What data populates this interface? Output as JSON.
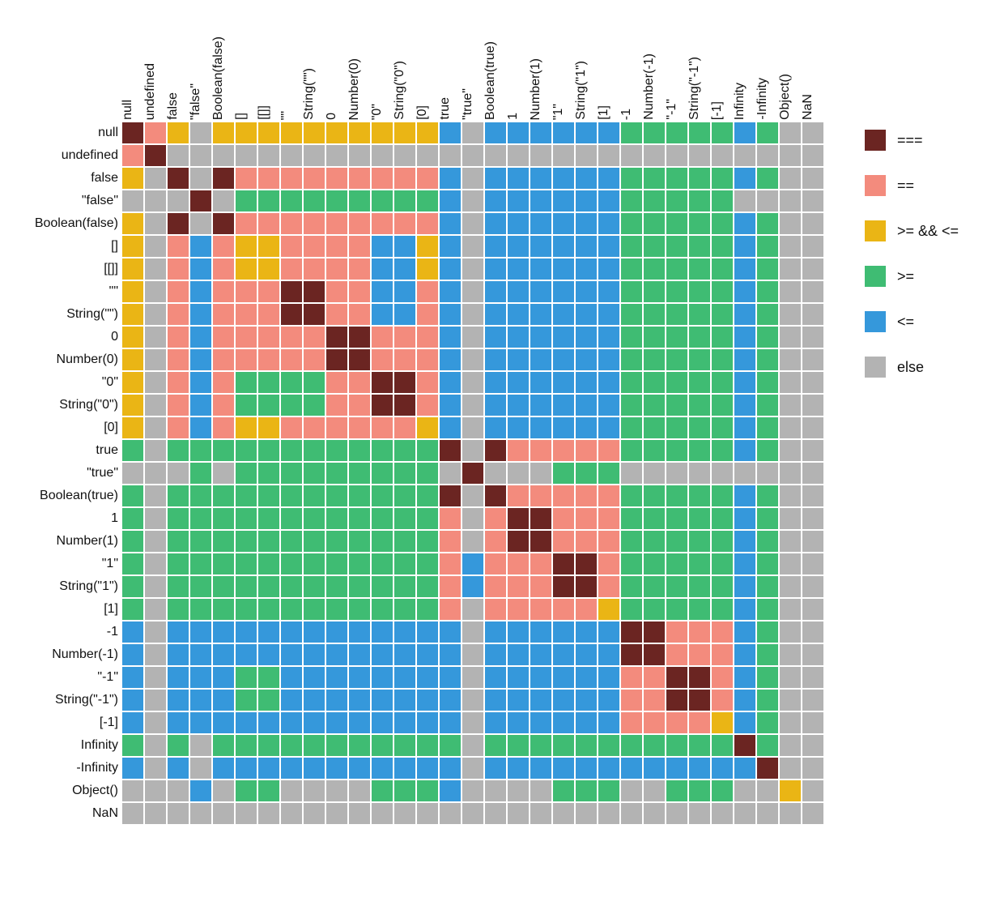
{
  "chart_data": {
    "type": "heatmap",
    "title": "",
    "xlabel": "",
    "ylabel": "",
    "labels": [
      "null",
      "undefined",
      "false",
      "\"false\"",
      "Boolean(false)",
      "[]",
      "[[]]",
      "\"\"",
      "String(\"\")",
      "0",
      "Number(0)",
      "\"0\"",
      "String(\"0\")",
      "[0]",
      "true",
      "\"true\"",
      "Boolean(true)",
      "1",
      "Number(1)",
      "\"1\"",
      "String(\"1\")",
      "[1]",
      "-1",
      "Number(-1)",
      "\"-1\"",
      "String(\"-1\")",
      "[-1]",
      "Infinity",
      "-Infinity",
      "Object()",
      "NaN"
    ],
    "categories": [
      {
        "key": "===",
        "label": "===",
        "color": "#6b2522"
      },
      {
        "key": "==",
        "label": "==",
        "color": "#f38b7d"
      },
      {
        "key": ">= && <=",
        "label": ">= && <=",
        "color": "#eab515"
      },
      {
        "key": ">=",
        "label": ">=",
        "color": "#3fbc73"
      },
      {
        "key": "<=",
        "label": "<=",
        "color": "#3598db"
      },
      {
        "key": "else",
        "label": "else",
        "color": "#b3b3b3"
      }
    ],
    "matrix_encoding": {
      "0": "===",
      "1": "==",
      "2": ">= && <=",
      "3": ">=",
      "4": "<=",
      "5": "else"
    },
    "matrix": [
      [
        0,
        1,
        2,
        5,
        2,
        2,
        2,
        2,
        2,
        2,
        2,
        2,
        2,
        2,
        4,
        5,
        4,
        4,
        4,
        4,
        4,
        4,
        3,
        3,
        3,
        3,
        3,
        4,
        3,
        5,
        5
      ],
      [
        1,
        0,
        5,
        5,
        5,
        5,
        5,
        5,
        5,
        5,
        5,
        5,
        5,
        5,
        5,
        5,
        5,
        5,
        5,
        5,
        5,
        5,
        5,
        5,
        5,
        5,
        5,
        5,
        5,
        5,
        5
      ],
      [
        2,
        5,
        0,
        5,
        0,
        1,
        1,
        1,
        1,
        1,
        1,
        1,
        1,
        1,
        4,
        5,
        4,
        4,
        4,
        4,
        4,
        4,
        3,
        3,
        3,
        3,
        3,
        4,
        3,
        5,
        5
      ],
      [
        5,
        5,
        5,
        0,
        5,
        3,
        3,
        3,
        3,
        3,
        3,
        3,
        3,
        3,
        4,
        5,
        4,
        4,
        4,
        4,
        4,
        4,
        3,
        3,
        3,
        3,
        3,
        5,
        5,
        5,
        5
      ],
      [
        2,
        5,
        0,
        5,
        0,
        1,
        1,
        1,
        1,
        1,
        1,
        1,
        1,
        1,
        4,
        5,
        4,
        4,
        4,
        4,
        4,
        4,
        3,
        3,
        3,
        3,
        3,
        4,
        3,
        5,
        5
      ],
      [
        2,
        5,
        1,
        4,
        1,
        2,
        2,
        1,
        1,
        1,
        1,
        4,
        4,
        2,
        4,
        5,
        4,
        4,
        4,
        4,
        4,
        4,
        3,
        3,
        3,
        3,
        3,
        4,
        3,
        5,
        5
      ],
      [
        2,
        5,
        1,
        4,
        1,
        2,
        2,
        1,
        1,
        1,
        1,
        4,
        4,
        2,
        4,
        5,
        4,
        4,
        4,
        4,
        4,
        4,
        3,
        3,
        3,
        3,
        3,
        4,
        3,
        5,
        5
      ],
      [
        2,
        5,
        1,
        4,
        1,
        1,
        1,
        0,
        0,
        1,
        1,
        4,
        4,
        1,
        4,
        5,
        4,
        4,
        4,
        4,
        4,
        4,
        3,
        3,
        3,
        3,
        3,
        4,
        3,
        5,
        5
      ],
      [
        2,
        5,
        1,
        4,
        1,
        1,
        1,
        0,
        0,
        1,
        1,
        4,
        4,
        1,
        4,
        5,
        4,
        4,
        4,
        4,
        4,
        4,
        3,
        3,
        3,
        3,
        3,
        4,
        3,
        5,
        5
      ],
      [
        2,
        5,
        1,
        4,
        1,
        1,
        1,
        1,
        1,
        0,
        0,
        1,
        1,
        1,
        4,
        5,
        4,
        4,
        4,
        4,
        4,
        4,
        3,
        3,
        3,
        3,
        3,
        4,
        3,
        5,
        5
      ],
      [
        2,
        5,
        1,
        4,
        1,
        1,
        1,
        1,
        1,
        0,
        0,
        1,
        1,
        1,
        4,
        5,
        4,
        4,
        4,
        4,
        4,
        4,
        3,
        3,
        3,
        3,
        3,
        4,
        3,
        5,
        5
      ],
      [
        2,
        5,
        1,
        4,
        1,
        3,
        3,
        3,
        3,
        1,
        1,
        0,
        0,
        1,
        4,
        5,
        4,
        4,
        4,
        4,
        4,
        4,
        3,
        3,
        3,
        3,
        3,
        4,
        3,
        5,
        5
      ],
      [
        2,
        5,
        1,
        4,
        1,
        3,
        3,
        3,
        3,
        1,
        1,
        0,
        0,
        1,
        4,
        5,
        4,
        4,
        4,
        4,
        4,
        4,
        3,
        3,
        3,
        3,
        3,
        4,
        3,
        5,
        5
      ],
      [
        2,
        5,
        1,
        4,
        1,
        2,
        2,
        1,
        1,
        1,
        1,
        1,
        1,
        2,
        4,
        5,
        4,
        4,
        4,
        4,
        4,
        4,
        3,
        3,
        3,
        3,
        3,
        4,
        3,
        5,
        5
      ],
      [
        3,
        5,
        3,
        3,
        3,
        3,
        3,
        3,
        3,
        3,
        3,
        3,
        3,
        3,
        0,
        5,
        0,
        1,
        1,
        1,
        1,
        1,
        3,
        3,
        3,
        3,
        3,
        4,
        3,
        5,
        5
      ],
      [
        5,
        5,
        5,
        3,
        5,
        3,
        3,
        3,
        3,
        3,
        3,
        3,
        3,
        3,
        5,
        0,
        5,
        5,
        5,
        3,
        3,
        3,
        5,
        5,
        5,
        5,
        5,
        5,
        5,
        5,
        5
      ],
      [
        3,
        5,
        3,
        3,
        3,
        3,
        3,
        3,
        3,
        3,
        3,
        3,
        3,
        3,
        0,
        5,
        0,
        1,
        1,
        1,
        1,
        1,
        3,
        3,
        3,
        3,
        3,
        4,
        3,
        5,
        5
      ],
      [
        3,
        5,
        3,
        3,
        3,
        3,
        3,
        3,
        3,
        3,
        3,
        3,
        3,
        3,
        1,
        5,
        1,
        0,
        0,
        1,
        1,
        1,
        3,
        3,
        3,
        3,
        3,
        4,
        3,
        5,
        5
      ],
      [
        3,
        5,
        3,
        3,
        3,
        3,
        3,
        3,
        3,
        3,
        3,
        3,
        3,
        3,
        1,
        5,
        1,
        0,
        0,
        1,
        1,
        1,
        3,
        3,
        3,
        3,
        3,
        4,
        3,
        5,
        5
      ],
      [
        3,
        5,
        3,
        3,
        3,
        3,
        3,
        3,
        3,
        3,
        3,
        3,
        3,
        3,
        1,
        4,
        1,
        1,
        1,
        0,
        0,
        1,
        3,
        3,
        3,
        3,
        3,
        4,
        3,
        5,
        5
      ],
      [
        3,
        5,
        3,
        3,
        3,
        3,
        3,
        3,
        3,
        3,
        3,
        3,
        3,
        3,
        1,
        4,
        1,
        1,
        1,
        0,
        0,
        1,
        3,
        3,
        3,
        3,
        3,
        4,
        3,
        5,
        5
      ],
      [
        3,
        5,
        3,
        3,
        3,
        3,
        3,
        3,
        3,
        3,
        3,
        3,
        3,
        3,
        1,
        5,
        1,
        1,
        1,
        1,
        1,
        2,
        3,
        3,
        3,
        3,
        3,
        4,
        3,
        5,
        5
      ],
      [
        4,
        5,
        4,
        4,
        4,
        4,
        4,
        4,
        4,
        4,
        4,
        4,
        4,
        4,
        4,
        5,
        4,
        4,
        4,
        4,
        4,
        4,
        0,
        0,
        1,
        1,
        1,
        4,
        3,
        5,
        5
      ],
      [
        4,
        5,
        4,
        4,
        4,
        4,
        4,
        4,
        4,
        4,
        4,
        4,
        4,
        4,
        4,
        5,
        4,
        4,
        4,
        4,
        4,
        4,
        0,
        0,
        1,
        1,
        1,
        4,
        3,
        5,
        5
      ],
      [
        4,
        5,
        4,
        4,
        4,
        3,
        3,
        4,
        4,
        4,
        4,
        4,
        4,
        4,
        4,
        5,
        4,
        4,
        4,
        4,
        4,
        4,
        1,
        1,
        0,
        0,
        1,
        4,
        3,
        5,
        5
      ],
      [
        4,
        5,
        4,
        4,
        4,
        3,
        3,
        4,
        4,
        4,
        4,
        4,
        4,
        4,
        4,
        5,
        4,
        4,
        4,
        4,
        4,
        4,
        1,
        1,
        0,
        0,
        1,
        4,
        3,
        5,
        5
      ],
      [
        4,
        5,
        4,
        4,
        4,
        4,
        4,
        4,
        4,
        4,
        4,
        4,
        4,
        4,
        4,
        5,
        4,
        4,
        4,
        4,
        4,
        4,
        1,
        1,
        1,
        1,
        2,
        4,
        3,
        5,
        5
      ],
      [
        3,
        5,
        3,
        5,
        3,
        3,
        3,
        3,
        3,
        3,
        3,
        3,
        3,
        3,
        3,
        5,
        3,
        3,
        3,
        3,
        3,
        3,
        3,
        3,
        3,
        3,
        3,
        0,
        3,
        5,
        5
      ],
      [
        4,
        5,
        4,
        5,
        4,
        4,
        4,
        4,
        4,
        4,
        4,
        4,
        4,
        4,
        4,
        5,
        4,
        4,
        4,
        4,
        4,
        4,
        4,
        4,
        4,
        4,
        4,
        4,
        0,
        5,
        5
      ],
      [
        5,
        5,
        5,
        4,
        5,
        3,
        3,
        5,
        5,
        5,
        5,
        3,
        3,
        3,
        4,
        5,
        5,
        5,
        5,
        3,
        3,
        3,
        5,
        5,
        3,
        3,
        3,
        5,
        5,
        2,
        5
      ],
      [
        5,
        5,
        5,
        5,
        5,
        5,
        5,
        5,
        5,
        5,
        5,
        5,
        5,
        5,
        5,
        5,
        5,
        5,
        5,
        5,
        5,
        5,
        5,
        5,
        5,
        5,
        5,
        5,
        5,
        5,
        5
      ]
    ]
  }
}
